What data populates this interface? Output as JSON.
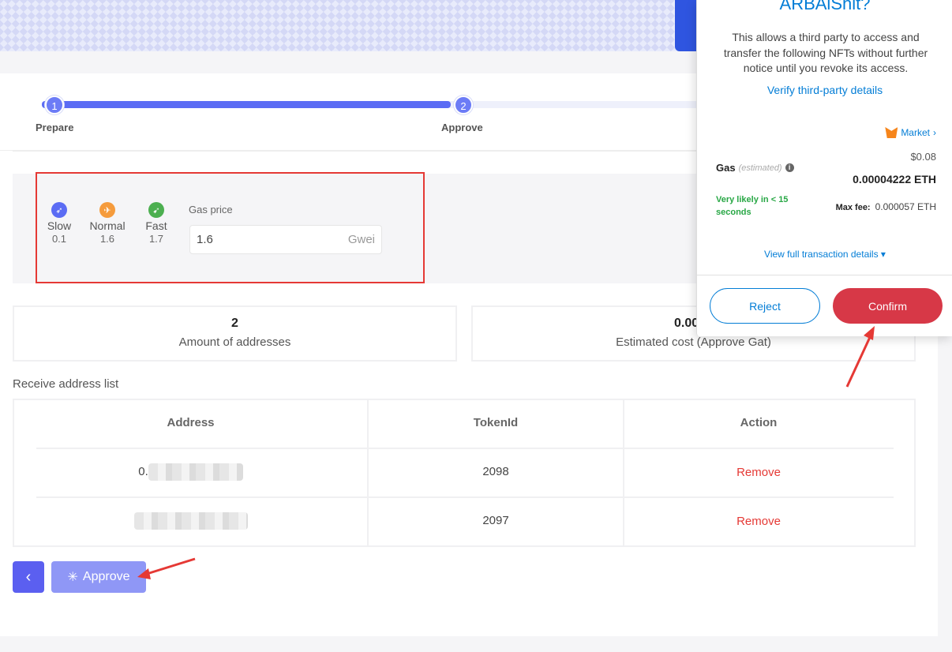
{
  "steps": [
    {
      "number": "1",
      "label": "Prepare"
    },
    {
      "number": "2",
      "label": "Approve"
    }
  ],
  "gas": {
    "speeds": [
      {
        "name": "Slow",
        "value": "0.1",
        "color": "#5b6cf4",
        "icon": "bird-icon"
      },
      {
        "name": "Normal",
        "value": "1.6",
        "color": "#f59b3c",
        "icon": "plane-icon"
      },
      {
        "name": "Fast",
        "value": "1.7",
        "color": "#4caf50",
        "icon": "rocket-icon"
      }
    ],
    "price_label": "Gas price",
    "price_value": "1.6",
    "unit": "Gwei"
  },
  "stats": {
    "addresses_count": "2",
    "addresses_label": "Amount of addresses",
    "cost_value": "0.0007",
    "cost_label": "Estimated cost  (Approve Gat)"
  },
  "list": {
    "title": "Receive address list",
    "headers": [
      "Address",
      "TokenId",
      "Action"
    ],
    "rows": [
      {
        "address_prefix": "0.",
        "token_id": "2098",
        "action": "Remove"
      },
      {
        "address_prefix": "",
        "token_id": "2097",
        "action": "Remove"
      }
    ]
  },
  "buttons": {
    "back": "‹",
    "approve": "Approve"
  },
  "popup": {
    "title": "ARBAiShit?",
    "description": "This allows a third party to access and transfer the following NFTs without further notice until you revoke its access.",
    "verify_link": "Verify third-party details",
    "market": "Market",
    "usd": "$0.08",
    "gas_label": "Gas",
    "gas_estimated": "(estimated)",
    "eth": "0.00004222 ETH",
    "likely": "Very likely in < 15 seconds",
    "max_fee_label": "Max fee:",
    "max_fee_value": "0.000057 ETH",
    "view_details": "View full transaction details",
    "reject": "Reject",
    "confirm": "Confirm"
  },
  "colors": {
    "primary": "#5b6cf4",
    "remove": "#e53935",
    "metamask_blue": "#037dd6",
    "confirm_red": "#d73847",
    "annotation_red": "#e53935"
  }
}
